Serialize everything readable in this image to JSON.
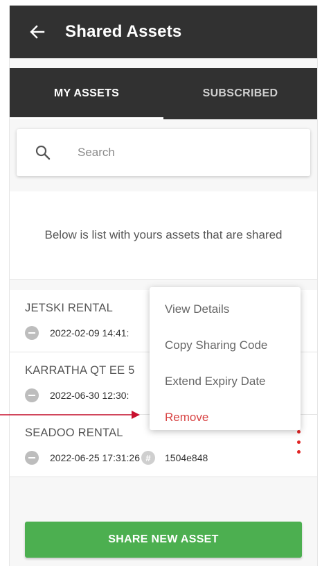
{
  "appbar": {
    "back_icon": "arrow-left-icon",
    "title": "Shared Assets"
  },
  "tabs": [
    {
      "label": "MY ASSETS",
      "active": true
    },
    {
      "label": "SUBSCRIBED",
      "active": false
    }
  ],
  "search": {
    "icon": "search-icon",
    "placeholder": "Search",
    "value": ""
  },
  "intro": {
    "text": "Below is list with yours assets that are shared"
  },
  "assets": [
    {
      "name": "JETSKI RENTAL",
      "timestamp": "2022-02-09 14:41:",
      "code": ""
    },
    {
      "name": "KARRATHA QT EE 5",
      "timestamp": "2022-06-30 12:30:",
      "code": ""
    },
    {
      "name": "SEADOO RENTAL",
      "timestamp": "2022-06-25 17:31:26",
      "code": "1504e848",
      "code_icon": "#"
    }
  ],
  "context_menu": {
    "items": [
      {
        "label": "View Details",
        "color": "#666666"
      },
      {
        "label": "Copy Sharing Code",
        "color": "#666666"
      },
      {
        "label": "Extend Expiry Date",
        "color": "#666666"
      },
      {
        "label": "Remove",
        "color": "#d84343"
      }
    ]
  },
  "share_button": {
    "label": "SHARE NEW ASSET",
    "color": "#4caf50"
  },
  "colors": {
    "appbar": "#313131",
    "accent_red": "#e02424",
    "annotation_arrow": "#c8102e"
  }
}
